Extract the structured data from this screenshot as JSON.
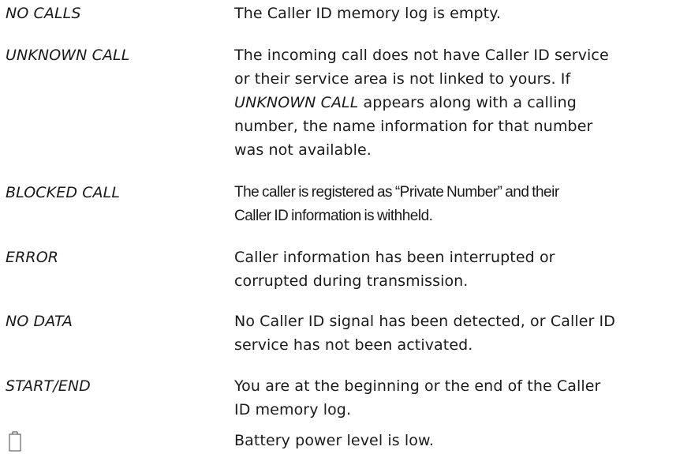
{
  "entries": [
    {
      "term": "NO CALLS",
      "description": "The Caller ID memory log is empty."
    },
    {
      "term": "UNKNOWN CALL",
      "description_line1": "The incoming call does not have Caller ID service",
      "description_line2": "or their service area is not linked to yours. If",
      "description_em": "UNKNOWN CALL",
      "description_line3_rest": " appears along with a calling",
      "description_line4": "number, the name information for that number",
      "description_line5": "was not available."
    },
    {
      "term": "BLOCKED CALL",
      "description_line1": "The caller is registered as “Private Number” and their",
      "description_line2": "Caller ID information is withheld."
    },
    {
      "term": "ERROR",
      "description_line1": "Caller information has been interrupted or",
      "description_line2": "corrupted during transmission."
    },
    {
      "term": "NO DATA",
      "description_line1": "No Caller ID signal has been detected, or Caller ID",
      "description_line2": "service has not been activated."
    },
    {
      "term": "START/END",
      "description_line1": "You are at the beginning or the end of the Caller",
      "description_line2": "ID memory log."
    },
    {
      "icon": "battery-low-icon",
      "description": "Battery power level is low."
    }
  ]
}
